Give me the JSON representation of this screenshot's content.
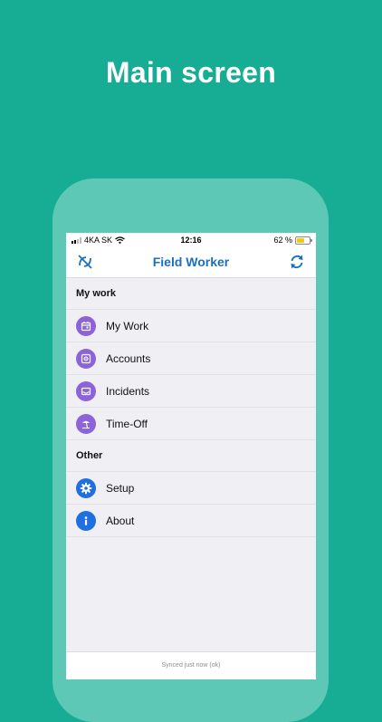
{
  "headline": "Main screen",
  "status_bar": {
    "carrier": "4KA SK",
    "time": "12:16",
    "battery": "62 %",
    "battery_level": 0.62
  },
  "navbar": {
    "title": "Field Worker",
    "left_icon": "sync-off-icon",
    "right_icon": "sync-icon"
  },
  "sections": [
    {
      "header": "My work",
      "items": [
        {
          "label": "My Work",
          "icon": "calendar-icon"
        },
        {
          "label": "Accounts",
          "icon": "contact-card-icon"
        },
        {
          "label": "Incidents",
          "icon": "inbox-icon"
        },
        {
          "label": "Time-Off",
          "icon": "beach-icon"
        }
      ]
    },
    {
      "header": "Other",
      "items": [
        {
          "label": "Setup",
          "icon": "gear-icon"
        },
        {
          "label": "About",
          "icon": "info-icon"
        }
      ]
    }
  ],
  "footer": {
    "sync_status": "Synced just now (ok)"
  },
  "colors": {
    "background": "#17ad94",
    "accent": "#1a6fc1",
    "purple_icon": "#8c63d9",
    "blue_icon": "#1f6fe0"
  }
}
